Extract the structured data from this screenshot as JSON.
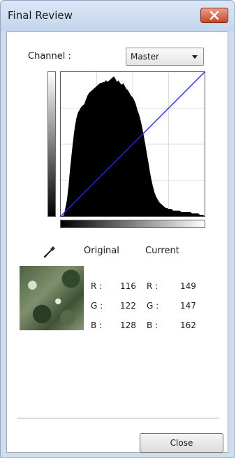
{
  "window": {
    "title": "Final Review"
  },
  "channel": {
    "label": "Channel :",
    "selected": "Master"
  },
  "columns": {
    "original": "Original",
    "current": "Current"
  },
  "original": {
    "r_label": "R :",
    "r": "116",
    "g_label": "G :",
    "g": "122",
    "b_label": "B :",
    "b": "128"
  },
  "current": {
    "r_label": "R :",
    "r": "149",
    "g_label": "G :",
    "g": "147",
    "b_label": "B :",
    "b": "162"
  },
  "footer": {
    "close_label": "Close"
  },
  "colors": {
    "tone_curve": "#1f2fd6",
    "histogram_fill": "#000000",
    "grid": "#dcdcdc"
  },
  "histogram": {
    "bins": [
      0,
      0,
      1,
      6,
      12,
      22,
      34,
      45,
      55,
      64,
      70,
      74,
      76,
      78,
      79,
      80,
      83,
      86,
      88,
      89,
      90,
      91,
      92,
      93,
      94,
      95,
      95,
      96,
      96,
      97,
      96,
      97,
      98,
      99,
      100,
      98,
      96,
      97,
      95,
      94,
      95,
      93,
      91,
      90,
      88,
      86,
      85,
      83,
      80,
      76,
      73,
      69,
      64,
      58,
      52,
      45,
      39,
      32,
      26,
      21,
      17,
      14,
      12,
      10,
      9,
      8,
      7,
      6,
      6,
      5,
      5,
      5,
      4,
      4,
      4,
      4,
      4,
      3,
      3,
      3,
      3,
      3,
      3,
      3,
      2,
      2,
      2,
      2,
      2,
      1,
      1,
      1,
      0
    ]
  }
}
